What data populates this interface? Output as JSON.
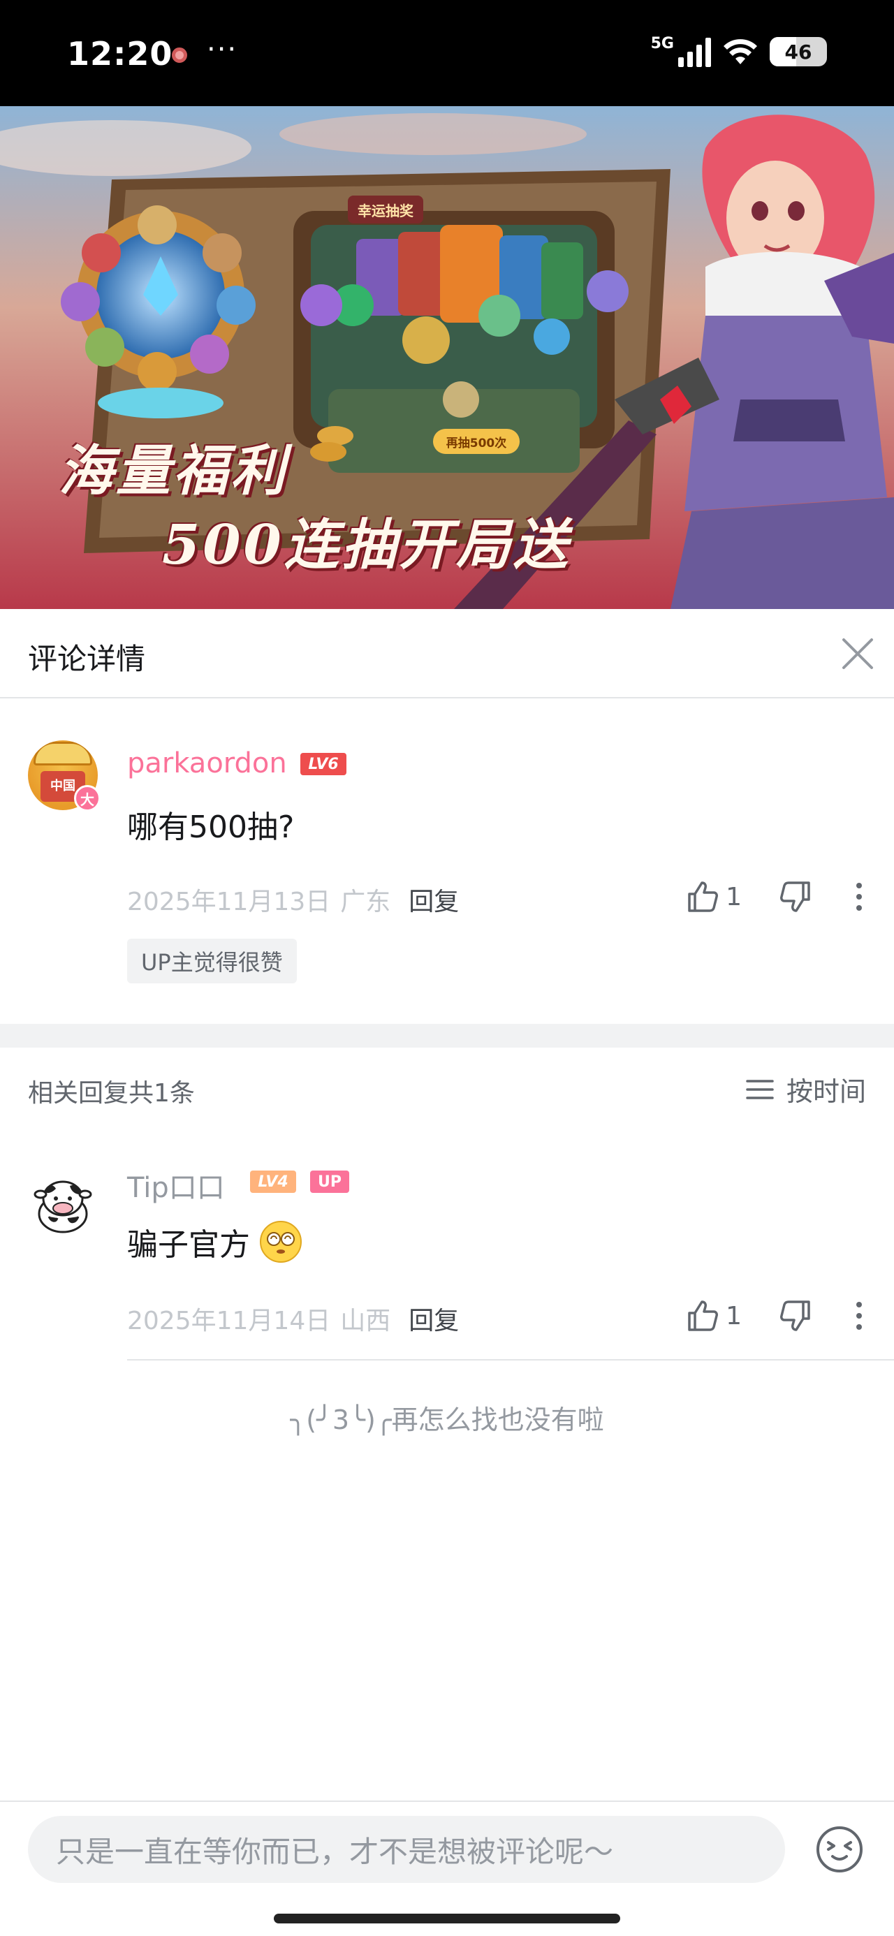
{
  "status_bar": {
    "time": "12:20",
    "more": "···",
    "network": "5G",
    "battery": "46"
  },
  "banner": {
    "line1": "海量福利",
    "line2": "500连抽开局送",
    "lucky_label": "幸运抽奖",
    "draw_label": "再抽500次"
  },
  "header": {
    "title": "评论详情"
  },
  "main_comment": {
    "avatar_text": "中国",
    "avatar_badge": "大",
    "username": "parkaordon",
    "level": "LV6",
    "content": "哪有500抽?",
    "date": "2025年11月13日",
    "location": "广东",
    "reply_label": "回复",
    "like_count": "1",
    "up_liked": "UP主觉得很赞"
  },
  "replies": {
    "count_label": "相关回复共1条",
    "sort_label": "按时间"
  },
  "reply_comment": {
    "username": "Tip口口",
    "level": "LV4",
    "up_badge": "UP",
    "content": "骗子官方",
    "date": "2025年11月14日",
    "location": "山西",
    "reply_label": "回复",
    "like_count": "1"
  },
  "end_text": "╮(╯3╰)╭再怎么找也没有啦",
  "bottom": {
    "input_placeholder": "只是一直在等你而已，才不是想被评论呢～"
  },
  "colors": {
    "accent_pink": "#fb7299",
    "level6": "#ee4d4d",
    "level4": "#ffb37c"
  }
}
